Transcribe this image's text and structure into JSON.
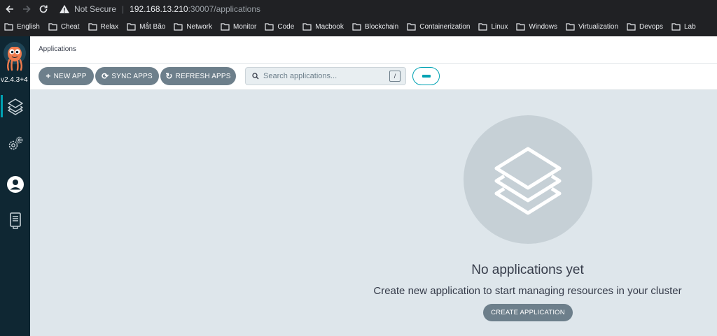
{
  "browser": {
    "not_secure": "Not Secure",
    "host": "192.168.13.210",
    "path": ":30007/applications"
  },
  "bookmarks": [
    "English",
    "Cheat",
    "Relax",
    "Mắt Bão",
    "Network",
    "Monitor",
    "Code",
    "Macbook",
    "Blockchain",
    "Containerization",
    "Linux",
    "Windows",
    "Virtualization",
    "Devops",
    "Lab"
  ],
  "sidebar": {
    "version": "v2.4.3+4",
    "items": [
      {
        "icon": "layers-icon",
        "active": true
      },
      {
        "icon": "gears-icon",
        "active": false
      },
      {
        "icon": "user-icon",
        "active": false
      },
      {
        "icon": "docs-icon",
        "active": false
      }
    ]
  },
  "header": {
    "title": "Applications"
  },
  "toolbar": {
    "new_app": "NEW APP",
    "sync_apps": "SYNC APPS",
    "refresh_apps": "REFRESH APPS",
    "search_placeholder": "Search applications...",
    "search_shortcut": "/"
  },
  "empty_state": {
    "title": "No applications yet",
    "subtitle": "Create new application to start managing resources in your cluster",
    "button": "CREATE APPLICATION"
  },
  "colors": {
    "sidebar_bg": "#0f2733",
    "accent": "#00a2b3",
    "button_bg": "#6d7f8b",
    "main_bg": "#dee6eb"
  }
}
